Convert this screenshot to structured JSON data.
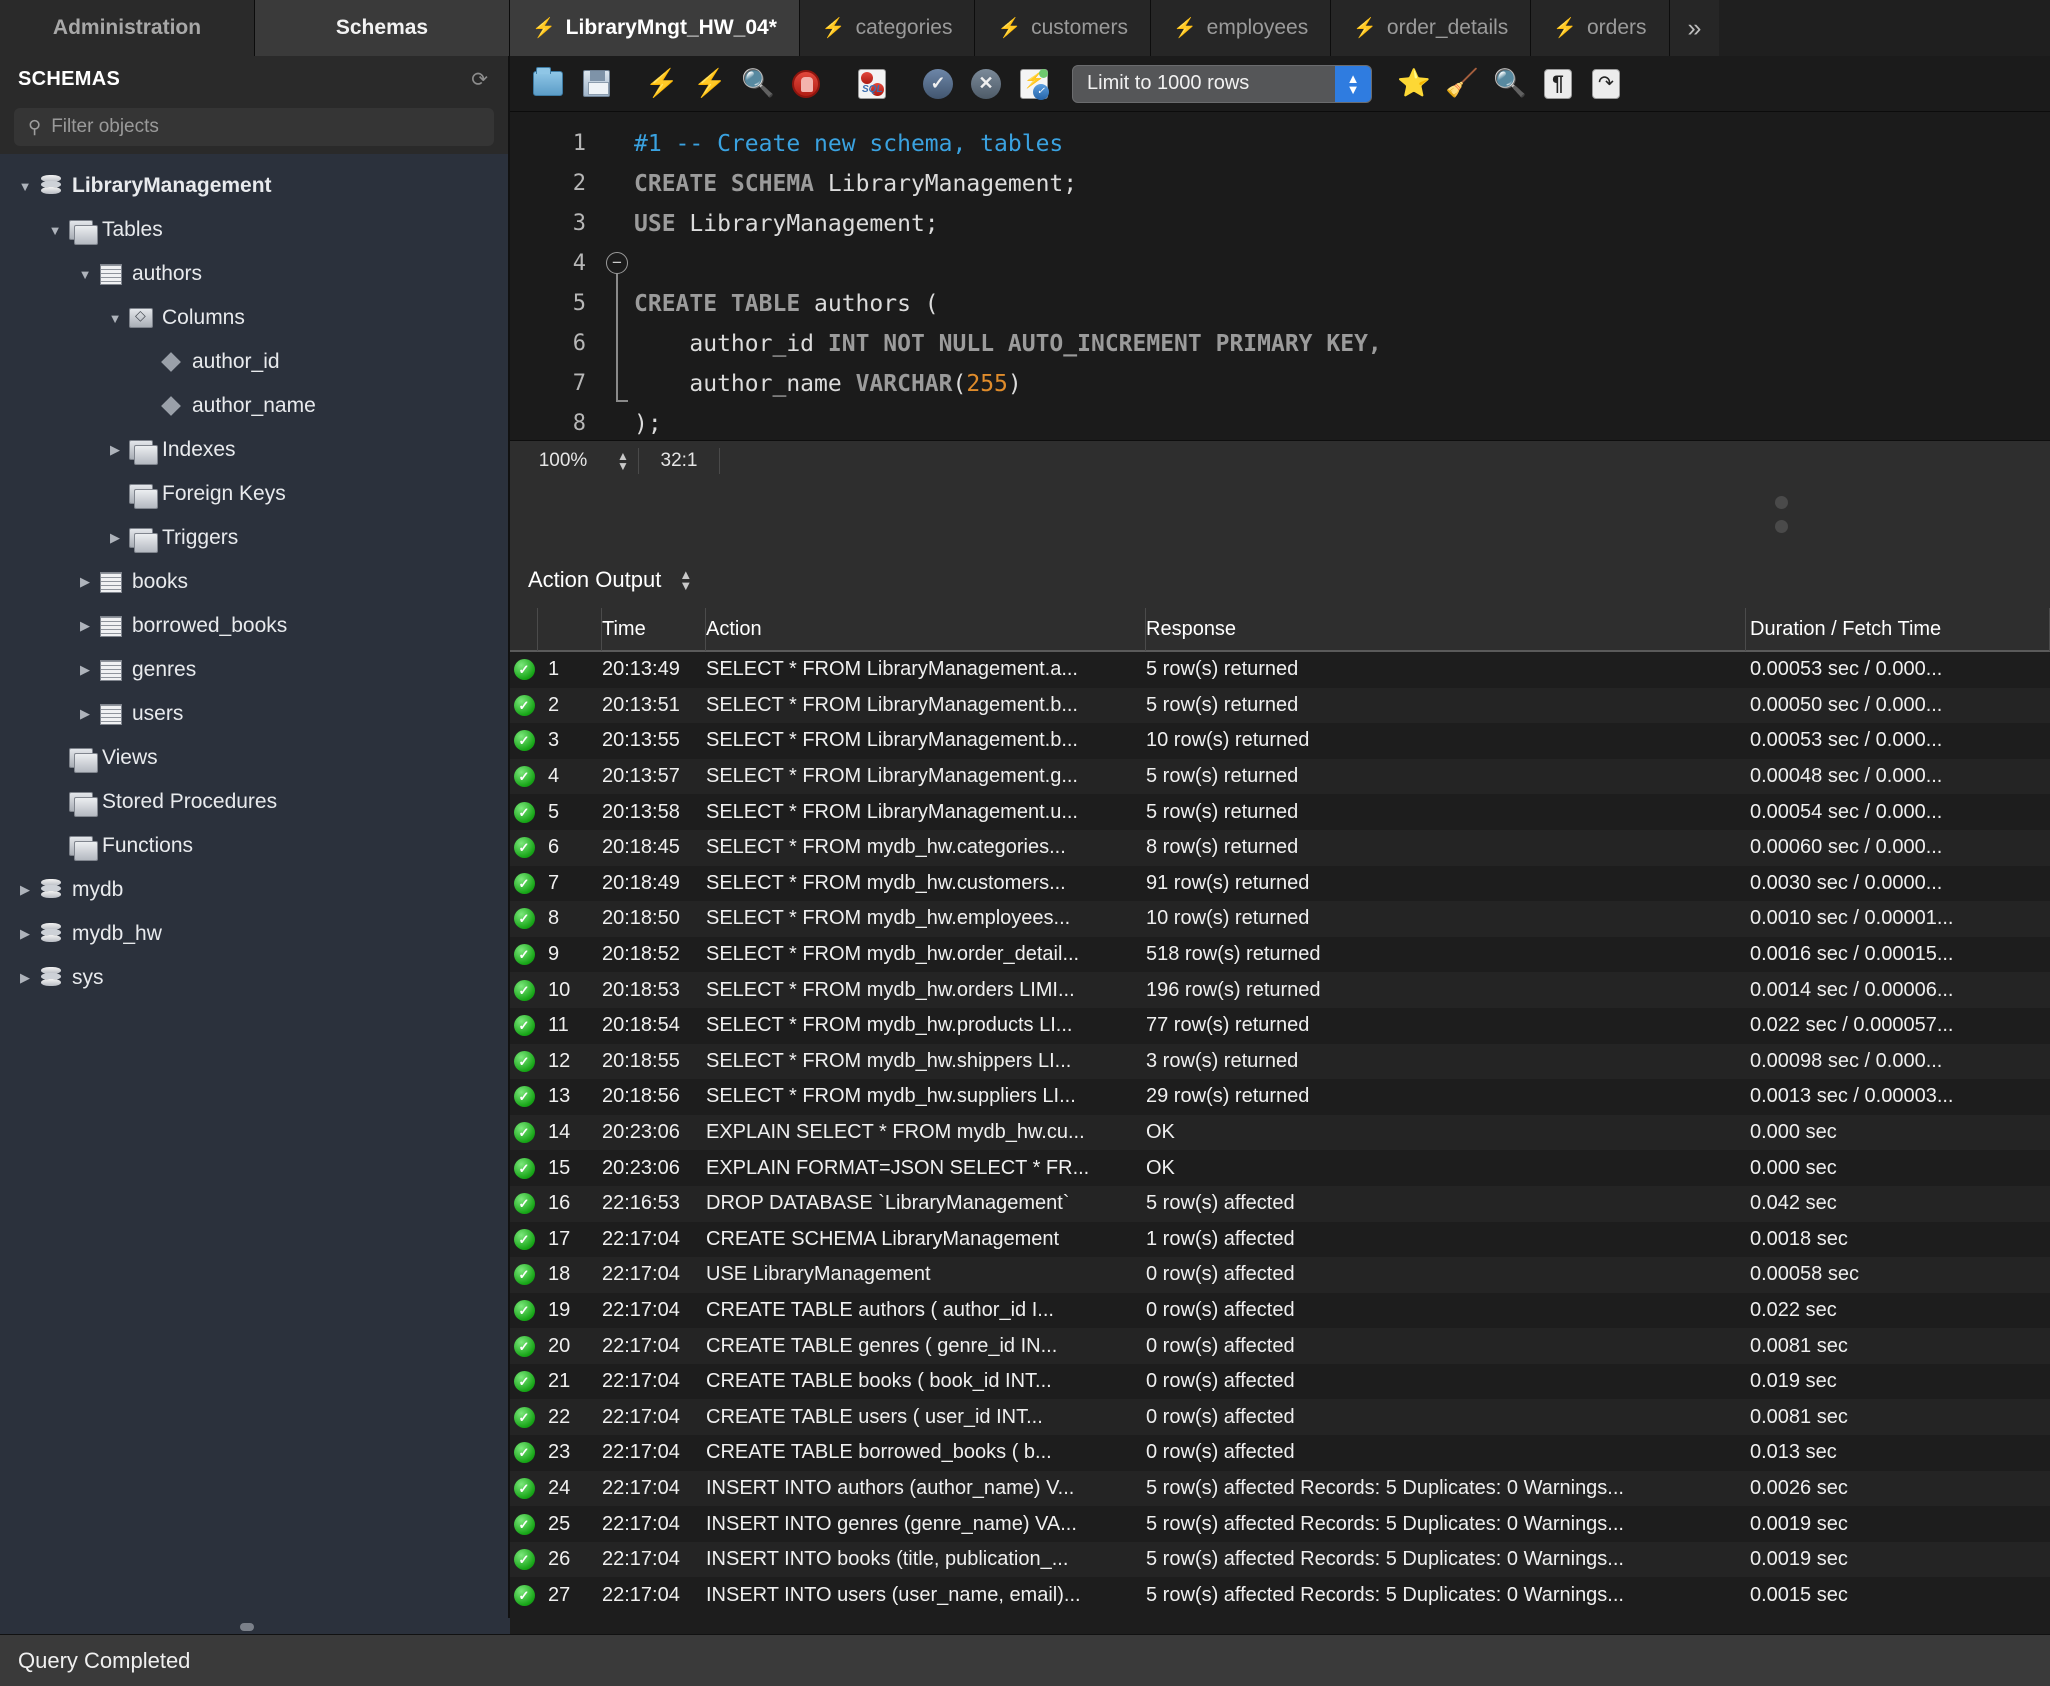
{
  "left_tabs": [
    {
      "label": "Administration",
      "active": false
    },
    {
      "label": "Schemas",
      "active": true
    }
  ],
  "editor_tabs": [
    {
      "label": "LibraryMngt_HW_04*",
      "icon": "lightning-icon",
      "active": true
    },
    {
      "label": "categories",
      "icon": "lightning-icon",
      "active": false
    },
    {
      "label": "customers",
      "icon": "lightning-icon",
      "active": false
    },
    {
      "label": "employees",
      "icon": "lightning-icon",
      "active": false
    },
    {
      "label": "order_details",
      "icon": "lightning-icon",
      "active": false
    },
    {
      "label": "orders",
      "icon": "lightning-icon",
      "active": false
    },
    {
      "label": "»",
      "icon": "overflow-icon",
      "active": false
    }
  ],
  "sidebar": {
    "title": "SCHEMAS",
    "refresh_icon": "refresh-icon",
    "filter_placeholder": "Filter objects",
    "filter_value": "",
    "tree": [
      {
        "label": "LibraryManagement",
        "icon": "database-icon",
        "depth": 0,
        "twisty": "open",
        "bold": true
      },
      {
        "label": "Tables",
        "icon": "folder-icon",
        "depth": 1,
        "twisty": "open",
        "bold": false
      },
      {
        "label": "authors",
        "icon": "table-icon",
        "depth": 2,
        "twisty": "open",
        "bold": false
      },
      {
        "label": "Columns",
        "icon": "columns-icon",
        "depth": 3,
        "twisty": "open",
        "bold": false
      },
      {
        "label": "author_id",
        "icon": "column-diamond-icon",
        "depth": 4,
        "twisty": "none",
        "bold": false
      },
      {
        "label": "author_name",
        "icon": "column-diamond-icon",
        "depth": 4,
        "twisty": "none",
        "bold": false
      },
      {
        "label": "Indexes",
        "icon": "folder-icon",
        "depth": 3,
        "twisty": "closed",
        "bold": false
      },
      {
        "label": "Foreign Keys",
        "icon": "folder-icon",
        "depth": 3,
        "twisty": "none",
        "bold": false
      },
      {
        "label": "Triggers",
        "icon": "folder-icon",
        "depth": 3,
        "twisty": "closed",
        "bold": false
      },
      {
        "label": "books",
        "icon": "table-icon",
        "depth": 2,
        "twisty": "closed",
        "bold": false
      },
      {
        "label": "borrowed_books",
        "icon": "table-icon",
        "depth": 2,
        "twisty": "closed",
        "bold": false
      },
      {
        "label": "genres",
        "icon": "table-icon",
        "depth": 2,
        "twisty": "closed",
        "bold": false
      },
      {
        "label": "users",
        "icon": "table-icon",
        "depth": 2,
        "twisty": "closed",
        "bold": false
      },
      {
        "label": "Views",
        "icon": "folder-icon",
        "depth": 1,
        "twisty": "none",
        "bold": false
      },
      {
        "label": "Stored Procedures",
        "icon": "folder-icon",
        "depth": 1,
        "twisty": "none",
        "bold": false
      },
      {
        "label": "Functions",
        "icon": "folder-icon",
        "depth": 1,
        "twisty": "none",
        "bold": false
      },
      {
        "label": "mydb",
        "icon": "database-icon",
        "depth": 0,
        "twisty": "closed",
        "bold": false
      },
      {
        "label": "mydb_hw",
        "icon": "database-icon",
        "depth": 0,
        "twisty": "closed",
        "bold": false
      },
      {
        "label": "sys",
        "icon": "database-icon",
        "depth": 0,
        "twisty": "closed",
        "bold": false
      }
    ]
  },
  "toolbar": {
    "buttons": [
      {
        "name": "open-sql-script-icon"
      },
      {
        "name": "save-script-icon"
      },
      {
        "name": "execute-statement-icon"
      },
      {
        "name": "execute-current-statement-icon"
      },
      {
        "name": "explain-query-icon"
      },
      {
        "name": "stop-execution-icon"
      },
      {
        "name": "toggle-stop-on-error-icon"
      },
      {
        "name": "commit-icon"
      },
      {
        "name": "rollback-icon"
      },
      {
        "name": "toggle-autocommit-icon"
      },
      {
        "name": "beautify-query-icon"
      },
      {
        "name": "find-icon"
      },
      {
        "name": "toggle-invisible-chars-icon"
      },
      {
        "name": "toggle-wrapping-icon"
      }
    ],
    "limit_label": "Limit to 1000 rows"
  },
  "code": {
    "lines": [
      {
        "n": "1",
        "tokens": [
          {
            "t": "#1 -- Create new schema, tables",
            "c": "cm"
          }
        ]
      },
      {
        "n": "2",
        "tokens": [
          {
            "t": "CREATE SCHEMA ",
            "c": "kw"
          },
          {
            "t": "LibraryManagement;",
            "c": "id"
          }
        ]
      },
      {
        "n": "3",
        "tokens": [
          {
            "t": "USE ",
            "c": "kw"
          },
          {
            "t": "LibraryManagement;",
            "c": "id"
          }
        ]
      },
      {
        "n": "4",
        "tokens": [
          {
            "t": "",
            "c": "id"
          }
        ]
      },
      {
        "n": "5",
        "tokens": [
          {
            "t": "CREATE TABLE ",
            "c": "kw"
          },
          {
            "t": "authors (",
            "c": "id"
          }
        ]
      },
      {
        "n": "6",
        "tokens": [
          {
            "t": "    author_id ",
            "c": "id"
          },
          {
            "t": "INT NOT NULL AUTO_INCREMENT PRIMARY KEY,",
            "c": "kw"
          }
        ]
      },
      {
        "n": "7",
        "tokens": [
          {
            "t": "    author_name ",
            "c": "id"
          },
          {
            "t": "VARCHAR",
            "c": "kw"
          },
          {
            "t": "(",
            "c": "id"
          },
          {
            "t": "255",
            "c": "num"
          },
          {
            "t": ")",
            "c": "id"
          }
        ]
      },
      {
        "n": "8",
        "tokens": [
          {
            "t": ");",
            "c": "id"
          }
        ]
      },
      {
        "n": "9",
        "tokens": [
          {
            "t": "",
            "c": "id"
          }
        ]
      }
    ]
  },
  "editor_status": {
    "zoom": "100%",
    "cursor_position": "32:1"
  },
  "output": {
    "panel_label": "Action Output",
    "columns": [
      "",
      "",
      "Time",
      "Action",
      "Response",
      "Duration / Fetch Time"
    ],
    "rows": [
      {
        "n": "1",
        "time": "20:13:49",
        "action": "SELECT * FROM LibraryManagement.a...",
        "response": "5 row(s) returned",
        "duration": "0.00053 sec / 0.000..."
      },
      {
        "n": "2",
        "time": "20:13:51",
        "action": "SELECT * FROM LibraryManagement.b...",
        "response": "5 row(s) returned",
        "duration": "0.00050 sec / 0.000..."
      },
      {
        "n": "3",
        "time": "20:13:55",
        "action": "SELECT * FROM LibraryManagement.b...",
        "response": "10 row(s) returned",
        "duration": "0.00053 sec / 0.000..."
      },
      {
        "n": "4",
        "time": "20:13:57",
        "action": "SELECT * FROM LibraryManagement.g...",
        "response": "5 row(s) returned",
        "duration": "0.00048 sec / 0.000..."
      },
      {
        "n": "5",
        "time": "20:13:58",
        "action": "SELECT * FROM LibraryManagement.u...",
        "response": "5 row(s) returned",
        "duration": "0.00054 sec / 0.000..."
      },
      {
        "n": "6",
        "time": "20:18:45",
        "action": "SELECT * FROM mydb_hw.categories...",
        "response": "8 row(s) returned",
        "duration": "0.00060 sec / 0.000..."
      },
      {
        "n": "7",
        "time": "20:18:49",
        "action": "SELECT * FROM mydb_hw.customers...",
        "response": "91 row(s) returned",
        "duration": "0.0030 sec / 0.0000..."
      },
      {
        "n": "8",
        "time": "20:18:50",
        "action": "SELECT * FROM mydb_hw.employees...",
        "response": "10 row(s) returned",
        "duration": "0.0010 sec / 0.00001..."
      },
      {
        "n": "9",
        "time": "20:18:52",
        "action": "SELECT * FROM mydb_hw.order_detail...",
        "response": "518 row(s) returned",
        "duration": "0.0016 sec / 0.00015..."
      },
      {
        "n": "10",
        "time": "20:18:53",
        "action": "SELECT * FROM mydb_hw.orders LIMI...",
        "response": "196 row(s) returned",
        "duration": "0.0014 sec / 0.00006..."
      },
      {
        "n": "11",
        "time": "20:18:54",
        "action": "SELECT * FROM mydb_hw.products LI...",
        "response": "77 row(s) returned",
        "duration": "0.022 sec / 0.000057..."
      },
      {
        "n": "12",
        "time": "20:18:55",
        "action": "SELECT * FROM mydb_hw.shippers LI...",
        "response": "3 row(s) returned",
        "duration": "0.00098 sec / 0.000..."
      },
      {
        "n": "13",
        "time": "20:18:56",
        "action": "SELECT * FROM mydb_hw.suppliers LI...",
        "response": "29 row(s) returned",
        "duration": "0.0013 sec / 0.00003..."
      },
      {
        "n": "14",
        "time": "20:23:06",
        "action": "EXPLAIN SELECT * FROM mydb_hw.cu...",
        "response": "OK",
        "duration": "0.000 sec"
      },
      {
        "n": "15",
        "time": "20:23:06",
        "action": "EXPLAIN FORMAT=JSON SELECT * FR...",
        "response": "OK",
        "duration": "0.000 sec"
      },
      {
        "n": "16",
        "time": "22:16:53",
        "action": "DROP DATABASE `LibraryManagement`",
        "response": "5 row(s) affected",
        "duration": "0.042 sec"
      },
      {
        "n": "17",
        "time": "22:17:04",
        "action": "CREATE SCHEMA LibraryManagement",
        "response": "1 row(s) affected",
        "duration": "0.0018 sec"
      },
      {
        "n": "18",
        "time": "22:17:04",
        "action": "USE LibraryManagement",
        "response": "0 row(s) affected",
        "duration": "0.00058 sec"
      },
      {
        "n": "19",
        "time": "22:17:04",
        "action": "CREATE TABLE authors (    author_id I...",
        "response": "0 row(s) affected",
        "duration": "0.022 sec"
      },
      {
        "n": "20",
        "time": "22:17:04",
        "action": "CREATE TABLE genres (    genre_id IN...",
        "response": "0 row(s) affected",
        "duration": "0.0081 sec"
      },
      {
        "n": "21",
        "time": "22:17:04",
        "action": "CREATE TABLE books (    book_id INT...",
        "response": "0 row(s) affected",
        "duration": "0.019 sec"
      },
      {
        "n": "22",
        "time": "22:17:04",
        "action": "CREATE TABLE users (    user_id INT...",
        "response": "0 row(s) affected",
        "duration": "0.0081 sec"
      },
      {
        "n": "23",
        "time": "22:17:04",
        "action": "CREATE TABLE borrowed_books (    b...",
        "response": "0 row(s) affected",
        "duration": "0.013 sec"
      },
      {
        "n": "24",
        "time": "22:17:04",
        "action": "INSERT INTO authors (author_name) V...",
        "response": "5 row(s) affected Records: 5  Duplicates: 0  Warnings...",
        "duration": "0.0026 sec"
      },
      {
        "n": "25",
        "time": "22:17:04",
        "action": "INSERT INTO genres (genre_name) VA...",
        "response": "5 row(s) affected Records: 5  Duplicates: 0  Warnings...",
        "duration": "0.0019 sec"
      },
      {
        "n": "26",
        "time": "22:17:04",
        "action": "INSERT INTO books (title, publication_...",
        "response": "5 row(s) affected Records: 5  Duplicates: 0  Warnings...",
        "duration": "0.0019 sec"
      },
      {
        "n": "27",
        "time": "22:17:04",
        "action": "INSERT INTO users (user_name, email)...",
        "response": "5 row(s) affected Records: 5  Duplicates: 0  Warnings...",
        "duration": "0.0015 sec"
      }
    ],
    "status_icon": "success-check-icon"
  },
  "statusbar": {
    "text": "Query Completed"
  },
  "colors": {
    "sidebar_bg": "#2b313c",
    "editor_bg": "#1b1b1b",
    "accent_blue": "#2f7ce0",
    "comment_blue": "#3aa2e0",
    "number_orange": "#e08c2b",
    "success_green": "#17a517"
  }
}
